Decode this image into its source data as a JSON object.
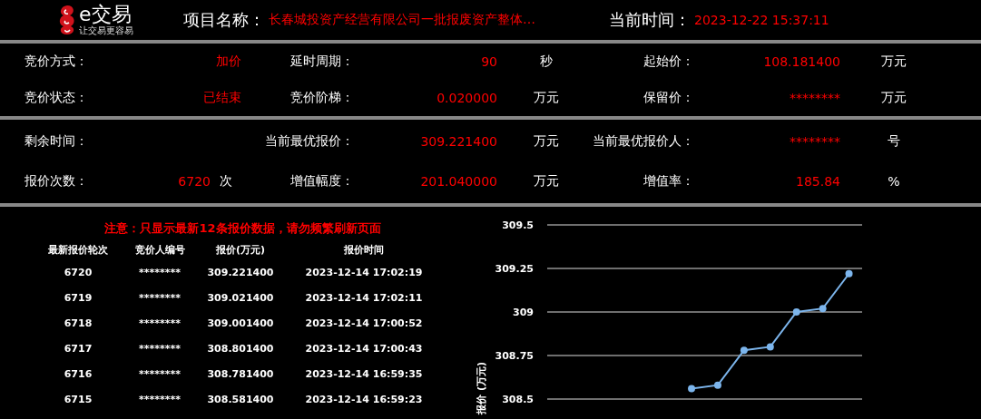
{
  "header": {
    "logo": {
      "name": "e交易",
      "slogan": "让交易更容易"
    },
    "project_label": "项目名称：",
    "project_name": "长春城投资产经营有限公司一批报废资产整体…",
    "time_label": "当前时间：",
    "time": "2023-12-22 15:37:11"
  },
  "sections": [
    {
      "rows": [
        [
          {
            "label": "竞价方式：",
            "value": "加价"
          },
          {
            "label": "延时周期：",
            "value": "90",
            "unit": "秒"
          },
          {
            "label": "起始价：",
            "value": "108.181400",
            "unit": "万元"
          }
        ],
        [
          {
            "label": "竞价状态：",
            "value": "已结束"
          },
          {
            "label": "竞价阶梯：",
            "value": "0.020000",
            "unit": "万元"
          },
          {
            "label": "保留价：",
            "value": "********",
            "unit": "万元"
          }
        ]
      ]
    },
    {
      "rows": [
        [
          {
            "label": "剩余时间："
          },
          {
            "label": "当前最优报价：",
            "value": "309.221400",
            "unit": "万元"
          },
          {
            "label": "当前最优报价人：",
            "value": "********",
            "unit": "号"
          }
        ],
        [
          {
            "label": "报价次数：",
            "value": "6720",
            "unit": "次"
          },
          {
            "label": "增值幅度：",
            "value": "201.040000",
            "unit": "万元"
          },
          {
            "label": "增值率：",
            "value": "185.84",
            "unit": "%"
          }
        ]
      ]
    }
  ],
  "bids": {
    "notice": "注意：只显示最新12条报价数据，请勿频繁刷新页面",
    "columns": [
      "最新报价轮次",
      "竞价人编号",
      "报价(万元)",
      "报价时间"
    ],
    "rows": [
      [
        "6720",
        "********",
        "309.221400",
        "2023-12-14 17:02:19"
      ],
      [
        "6719",
        "********",
        "309.021400",
        "2023-12-14 17:02:11"
      ],
      [
        "6718",
        "********",
        "309.001400",
        "2023-12-14 17:00:52"
      ],
      [
        "6717",
        "********",
        "308.801400",
        "2023-12-14 17:00:43"
      ],
      [
        "6716",
        "********",
        "308.781400",
        "2023-12-14 16:59:35"
      ],
      [
        "6715",
        "********",
        "308.581400",
        "2023-12-14 16:59:23"
      ]
    ]
  },
  "chart": {
    "chart_data": {
      "type": "line",
      "ylabel": "报价 (万元)",
      "ylim": [
        308.5,
        309.5
      ],
      "yticks": [
        308.5,
        308.75,
        309,
        309.25,
        309.5
      ],
      "grid": true,
      "series": [
        {
          "color": "#7cb5ec",
          "marker": true,
          "values": [
            null,
            null,
            null,
            null,
            null,
            308.56,
            308.58,
            308.78,
            308.8,
            309,
            309.02,
            309.22
          ]
        }
      ]
    }
  }
}
